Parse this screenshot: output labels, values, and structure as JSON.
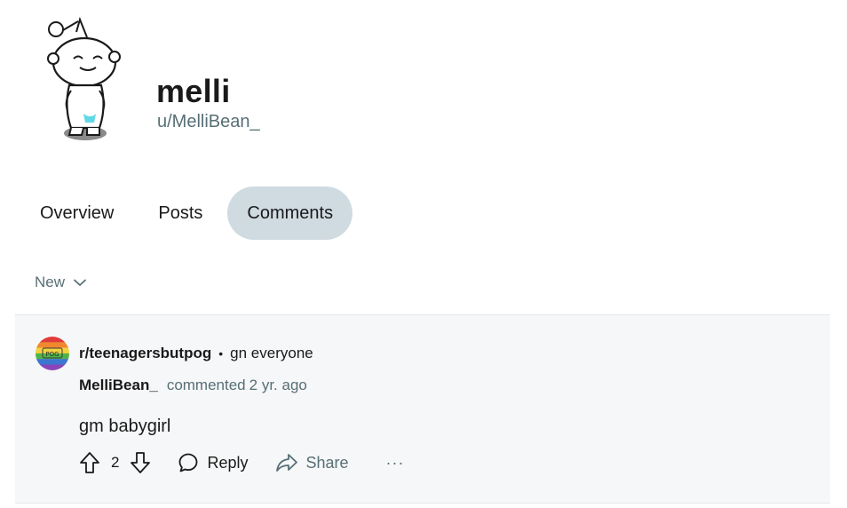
{
  "profile": {
    "display_name": "melli",
    "username": "u/MelliBean_"
  },
  "tabs": [
    {
      "label": "Overview",
      "active": false
    },
    {
      "label": "Posts",
      "active": false
    },
    {
      "label": "Comments",
      "active": true
    }
  ],
  "sort": {
    "label": "New"
  },
  "comment": {
    "subreddit": "r/teenagersbutpog",
    "post_title": "gn everyone",
    "author": "MelliBean_",
    "action": "commented",
    "time": "2 yr. ago",
    "body": "gm babygirl",
    "score": "2",
    "reply_label": "Reply",
    "share_label": "Share",
    "more_label": "···"
  },
  "colors": {
    "active_tab_bg": "#cfdbe1",
    "muted_text": "#576f76",
    "card_bg": "#f6f7f8"
  }
}
